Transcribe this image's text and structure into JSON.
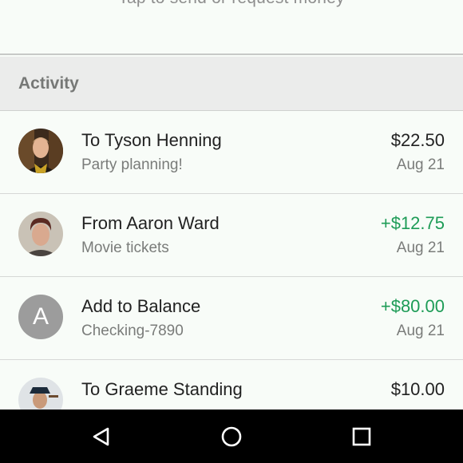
{
  "header": {
    "hint_text": "Tap to send or request money"
  },
  "activity": {
    "title": "Activity",
    "items": [
      {
        "title": "To Tyson Henning",
        "subtitle": "Party planning!",
        "amount": "$22.50",
        "date": "Aug 21",
        "avatar_letter": ""
      },
      {
        "title": "From Aaron Ward",
        "subtitle": "Movie tickets",
        "amount": "+$12.75",
        "date": "Aug 21",
        "avatar_letter": ""
      },
      {
        "title": "Add to Balance",
        "subtitle": "Checking-7890",
        "amount": "+$80.00",
        "date": "Aug 21",
        "avatar_letter": "A"
      },
      {
        "title": "To Graeme Standing",
        "subtitle": "",
        "amount": "$10.00",
        "date": "",
        "avatar_letter": ""
      }
    ]
  },
  "colors": {
    "positive_amount": "#1e9c57",
    "default_text": "#222222",
    "secondary_text": "#7a7c7a",
    "navbar": "#000000"
  },
  "navigation": {
    "icons": [
      "back-icon",
      "home-icon",
      "recents-icon"
    ]
  }
}
